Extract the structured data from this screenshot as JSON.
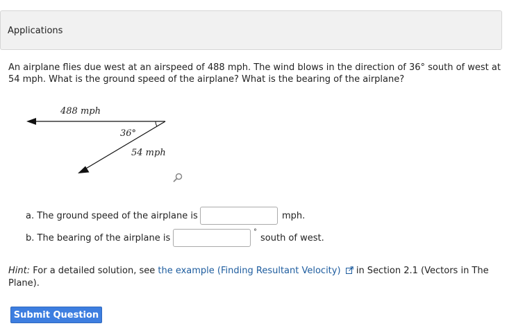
{
  "header": {
    "title": "Applications"
  },
  "problem": {
    "text": "An airplane flies due west at an airspeed of 488 mph. The wind blows in the direction of 36° south of west at 54 mph. What is the ground speed of the airplane? What is the bearing of the airplane?"
  },
  "diagram": {
    "airspeed_label": "488 mph",
    "angle_label": "36°",
    "wind_label": "54 mph"
  },
  "questions": {
    "a_text": "a. The ground speed of the airplane is",
    "a_unit": "mph.",
    "a_value": "",
    "b_text": "b. The bearing of the airplane is",
    "b_degree": "°",
    "b_unit": "south of west.",
    "b_value": ""
  },
  "hint": {
    "label": "Hint:",
    "before": "For a detailed solution, see",
    "link_text": "the example (Finding Resultant Velocity)",
    "after": "in Section 2.1 (Vectors in The Plane)."
  },
  "submit": {
    "label": "Submit Question"
  },
  "colors": {
    "accent": "#3d7ee0",
    "link": "#1d5c9e",
    "header_bg": "#f1f1f1"
  },
  "icons": {
    "magnify": "magnify-icon",
    "external_link": "external-link-icon"
  }
}
